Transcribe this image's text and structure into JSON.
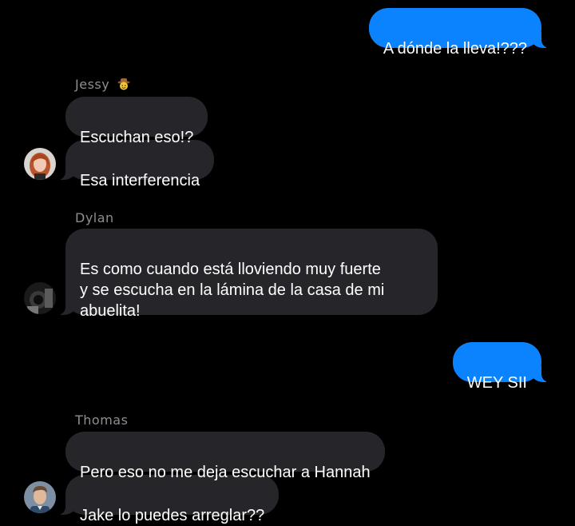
{
  "messages": [
    {
      "id": "m1",
      "direction": "out",
      "text": "A dónde la lleva!???"
    },
    {
      "id": "m2",
      "direction": "in",
      "sender": "Jessy",
      "text": "Escuchan eso!?"
    },
    {
      "id": "m3",
      "direction": "in",
      "sender": "Jessy",
      "text": "Esa interferencia"
    },
    {
      "id": "m4",
      "direction": "in",
      "sender": "Dylan",
      "text": "Es como cuando está lloviendo muy fuerte\ny se escucha en la lámina de la casa de mi\nabuelita!"
    },
    {
      "id": "m5",
      "direction": "out",
      "text": "WEY SII"
    },
    {
      "id": "m6",
      "direction": "in",
      "sender": "Thomas",
      "text": "Pero eso no me deja escuchar a Hannah"
    },
    {
      "id": "m7",
      "direction": "in",
      "sender": "Thomas",
      "text": "Jake lo puedes arreglar??"
    }
  ],
  "senders": {
    "jessy": {
      "name": "Jessy",
      "emoji": "cowboy-face-icon"
    },
    "dylan": {
      "name": "Dylan"
    },
    "thomas": {
      "name": "Thomas"
    }
  },
  "colors": {
    "background": "#000000",
    "incoming_bubble": "#26252a",
    "outgoing_bubble": "#0b82fe",
    "sender_label": "#8e8e93"
  }
}
